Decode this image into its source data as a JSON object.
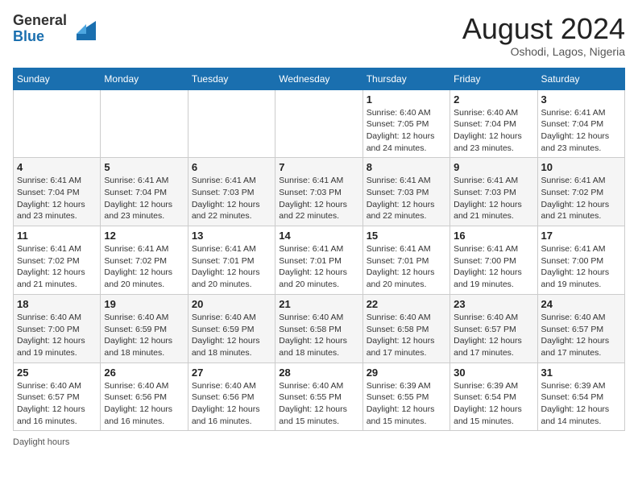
{
  "header": {
    "logo_general": "General",
    "logo_blue": "Blue",
    "month_year": "August 2024",
    "location": "Oshodi, Lagos, Nigeria"
  },
  "days_of_week": [
    "Sunday",
    "Monday",
    "Tuesday",
    "Wednesday",
    "Thursday",
    "Friday",
    "Saturday"
  ],
  "weeks": [
    [
      {
        "day": "",
        "info": ""
      },
      {
        "day": "",
        "info": ""
      },
      {
        "day": "",
        "info": ""
      },
      {
        "day": "",
        "info": ""
      },
      {
        "day": "1",
        "info": "Sunrise: 6:40 AM\nSunset: 7:05 PM\nDaylight: 12 hours and 24 minutes."
      },
      {
        "day": "2",
        "info": "Sunrise: 6:40 AM\nSunset: 7:04 PM\nDaylight: 12 hours and 23 minutes."
      },
      {
        "day": "3",
        "info": "Sunrise: 6:41 AM\nSunset: 7:04 PM\nDaylight: 12 hours and 23 minutes."
      }
    ],
    [
      {
        "day": "4",
        "info": "Sunrise: 6:41 AM\nSunset: 7:04 PM\nDaylight: 12 hours and 23 minutes."
      },
      {
        "day": "5",
        "info": "Sunrise: 6:41 AM\nSunset: 7:04 PM\nDaylight: 12 hours and 23 minutes."
      },
      {
        "day": "6",
        "info": "Sunrise: 6:41 AM\nSunset: 7:03 PM\nDaylight: 12 hours and 22 minutes."
      },
      {
        "day": "7",
        "info": "Sunrise: 6:41 AM\nSunset: 7:03 PM\nDaylight: 12 hours and 22 minutes."
      },
      {
        "day": "8",
        "info": "Sunrise: 6:41 AM\nSunset: 7:03 PM\nDaylight: 12 hours and 22 minutes."
      },
      {
        "day": "9",
        "info": "Sunrise: 6:41 AM\nSunset: 7:03 PM\nDaylight: 12 hours and 21 minutes."
      },
      {
        "day": "10",
        "info": "Sunrise: 6:41 AM\nSunset: 7:02 PM\nDaylight: 12 hours and 21 minutes."
      }
    ],
    [
      {
        "day": "11",
        "info": "Sunrise: 6:41 AM\nSunset: 7:02 PM\nDaylight: 12 hours and 21 minutes."
      },
      {
        "day": "12",
        "info": "Sunrise: 6:41 AM\nSunset: 7:02 PM\nDaylight: 12 hours and 20 minutes."
      },
      {
        "day": "13",
        "info": "Sunrise: 6:41 AM\nSunset: 7:01 PM\nDaylight: 12 hours and 20 minutes."
      },
      {
        "day": "14",
        "info": "Sunrise: 6:41 AM\nSunset: 7:01 PM\nDaylight: 12 hours and 20 minutes."
      },
      {
        "day": "15",
        "info": "Sunrise: 6:41 AM\nSunset: 7:01 PM\nDaylight: 12 hours and 20 minutes."
      },
      {
        "day": "16",
        "info": "Sunrise: 6:41 AM\nSunset: 7:00 PM\nDaylight: 12 hours and 19 minutes."
      },
      {
        "day": "17",
        "info": "Sunrise: 6:41 AM\nSunset: 7:00 PM\nDaylight: 12 hours and 19 minutes."
      }
    ],
    [
      {
        "day": "18",
        "info": "Sunrise: 6:40 AM\nSunset: 7:00 PM\nDaylight: 12 hours and 19 minutes."
      },
      {
        "day": "19",
        "info": "Sunrise: 6:40 AM\nSunset: 6:59 PM\nDaylight: 12 hours and 18 minutes."
      },
      {
        "day": "20",
        "info": "Sunrise: 6:40 AM\nSunset: 6:59 PM\nDaylight: 12 hours and 18 minutes."
      },
      {
        "day": "21",
        "info": "Sunrise: 6:40 AM\nSunset: 6:58 PM\nDaylight: 12 hours and 18 minutes."
      },
      {
        "day": "22",
        "info": "Sunrise: 6:40 AM\nSunset: 6:58 PM\nDaylight: 12 hours and 17 minutes."
      },
      {
        "day": "23",
        "info": "Sunrise: 6:40 AM\nSunset: 6:57 PM\nDaylight: 12 hours and 17 minutes."
      },
      {
        "day": "24",
        "info": "Sunrise: 6:40 AM\nSunset: 6:57 PM\nDaylight: 12 hours and 17 minutes."
      }
    ],
    [
      {
        "day": "25",
        "info": "Sunrise: 6:40 AM\nSunset: 6:57 PM\nDaylight: 12 hours and 16 minutes."
      },
      {
        "day": "26",
        "info": "Sunrise: 6:40 AM\nSunset: 6:56 PM\nDaylight: 12 hours and 16 minutes."
      },
      {
        "day": "27",
        "info": "Sunrise: 6:40 AM\nSunset: 6:56 PM\nDaylight: 12 hours and 16 minutes."
      },
      {
        "day": "28",
        "info": "Sunrise: 6:40 AM\nSunset: 6:55 PM\nDaylight: 12 hours and 15 minutes."
      },
      {
        "day": "29",
        "info": "Sunrise: 6:39 AM\nSunset: 6:55 PM\nDaylight: 12 hours and 15 minutes."
      },
      {
        "day": "30",
        "info": "Sunrise: 6:39 AM\nSunset: 6:54 PM\nDaylight: 12 hours and 15 minutes."
      },
      {
        "day": "31",
        "info": "Sunrise: 6:39 AM\nSunset: 6:54 PM\nDaylight: 12 hours and 14 minutes."
      }
    ]
  ],
  "footer": {
    "daylight_label": "Daylight hours"
  }
}
